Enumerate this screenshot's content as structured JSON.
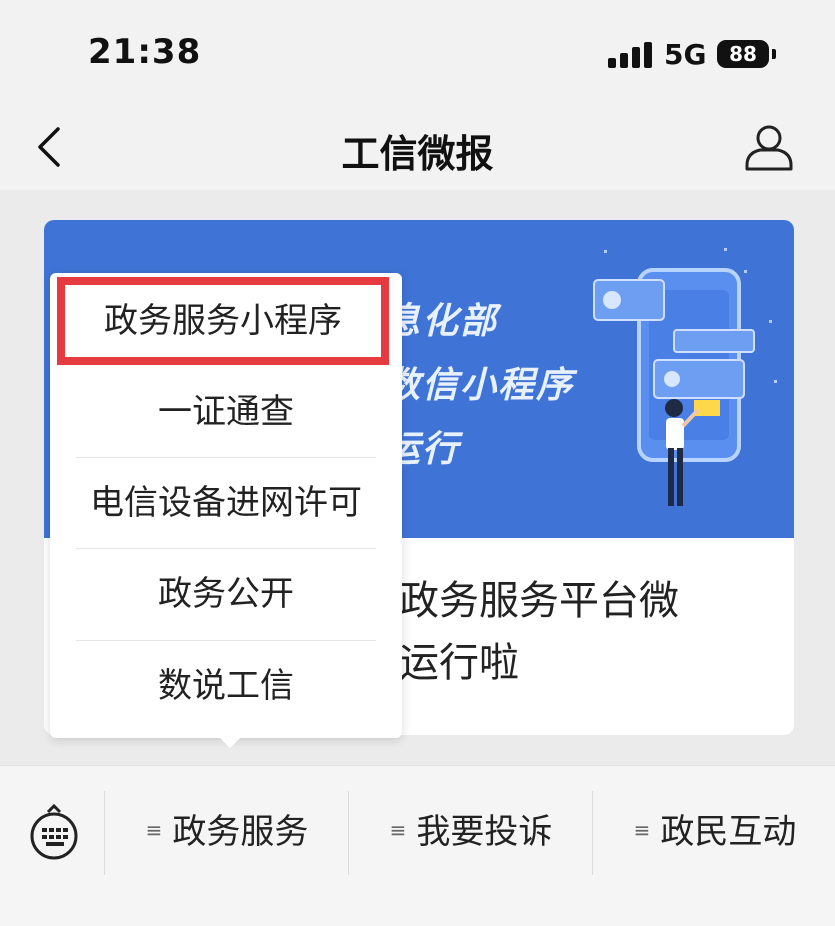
{
  "status": {
    "time": "21:38",
    "network": "5G",
    "battery": "88"
  },
  "nav": {
    "title": "工信微报"
  },
  "article": {
    "banner_lines": [
      "息化部",
      "数信小程序",
      "运行"
    ],
    "title_lines": [
      "政务服务平台微",
      "运行啦"
    ]
  },
  "popup_menu": {
    "items": [
      {
        "label": "政务服务小程序",
        "highlighted": true
      },
      {
        "label": "一证通查"
      },
      {
        "label": "电信设备进网许可"
      },
      {
        "label": "政务公开"
      },
      {
        "label": "数说工信"
      }
    ],
    "highlight_color": "#e53a40"
  },
  "bottom_bar": {
    "menus": [
      {
        "label": "政务服务",
        "icon": "menu-lines-icon"
      },
      {
        "label": "我要投诉",
        "icon": "menu-lines-icon"
      },
      {
        "label": "政民互动",
        "icon": "menu-lines-icon"
      }
    ]
  },
  "colors": {
    "banner_blue": "#3f74d6",
    "accent_red": "#e53a40"
  }
}
